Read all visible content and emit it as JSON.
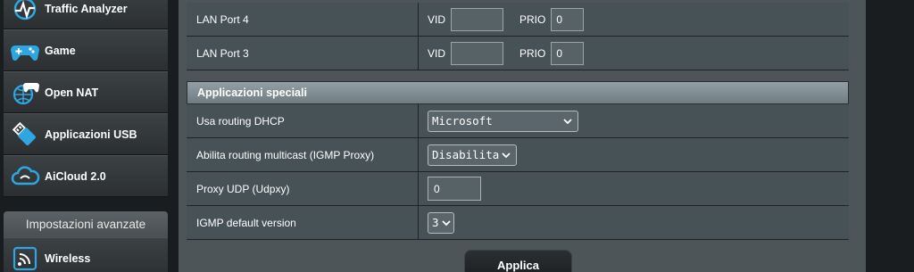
{
  "sidebar": {
    "items": [
      {
        "label": "Traffic Analyzer",
        "icon": "traffic-analyzer-icon"
      },
      {
        "label": "Game",
        "icon": "gamepad-icon"
      },
      {
        "label": "Open NAT",
        "icon": "open-nat-icon"
      },
      {
        "label": "Applicazioni USB",
        "icon": "usb-icon"
      },
      {
        "label": "AiCloud 2.0",
        "icon": "cloud-icon"
      }
    ],
    "advanced_header": "Impostazioni avanzate",
    "advanced_items": [
      {
        "label": "Wireless",
        "icon": "wireless-icon"
      }
    ]
  },
  "lan_ports": [
    {
      "label": "LAN Port 4",
      "vid_label": "VID",
      "vid_value": "",
      "prio_label": "PRIO",
      "prio_value": "0"
    },
    {
      "label": "LAN Port 3",
      "vid_label": "VID",
      "vid_value": "",
      "prio_label": "PRIO",
      "prio_value": "0"
    }
  ],
  "special_apps": {
    "title": "Applicazioni speciali",
    "dhcp_routing": {
      "label": "Usa routing DHCP",
      "value": "Microsoft"
    },
    "multicast_routing": {
      "label": "Abilita routing multicast (IGMP Proxy)",
      "value": "Disabilita"
    },
    "udp_proxy": {
      "label": "Proxy UDP (Udpxy)",
      "value": "0"
    },
    "igmp_version": {
      "label": "IGMP default version",
      "value": "3"
    }
  },
  "apply_button": "Applica",
  "colors": {
    "icon_blue": "#2ea7e0",
    "panel": "#475256",
    "section_header": "#7f8d93"
  }
}
